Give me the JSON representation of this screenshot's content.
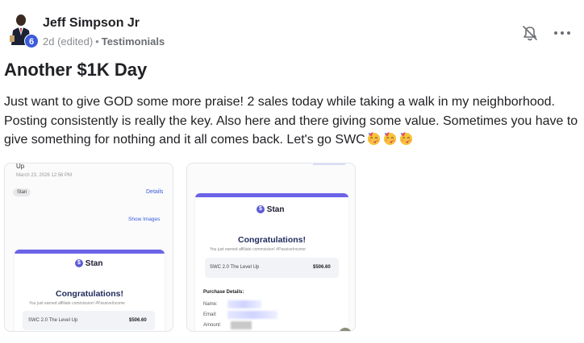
{
  "post": {
    "author": "Jeff Simpson Jr",
    "level": "6",
    "time": "2d (edited)",
    "separator": "•",
    "category": "Testimonials",
    "title": "Another $1K Day",
    "body": "Just want to give GOD some more praise! 2 sales today while taking a walk in my neighborhood. Posting consistently is really the key. Also here and there giving some value. Sometimes you have to give something for nothing and it all comes back. Let's go SWC",
    "emojis": [
      "partying-face",
      "partying-face",
      "partying-face"
    ]
  },
  "icons": {
    "bell": "bell-off-icon",
    "more": "more-horizontal-icon"
  },
  "attachment1": {
    "top_cut": "Up",
    "date": "March 23, 2026 12:56 PM",
    "tag": "Stan",
    "details_link": "Details",
    "show_images_link": "Show Images",
    "logo": "Stan",
    "congrats": "Congratulations!",
    "subtext": "You just earned affiliate commission! #PassiveIncome",
    "product": "SWC 2.0 The Level Up",
    "amount": "$506.60"
  },
  "attachment2": {
    "logo": "Stan",
    "congrats": "Congratulations!",
    "subtext": "You just earned affiliate commission! #PassiveIncome",
    "product": "SWC 2.0 The Level Up",
    "amount": "$506.60",
    "purchase_details": "Purchase Details:",
    "name_label": "Name:",
    "email_label": "Email:",
    "amount_label": "Amount:"
  },
  "colors": {
    "accent": "#6c63e8",
    "badge": "#3b5bdb"
  }
}
